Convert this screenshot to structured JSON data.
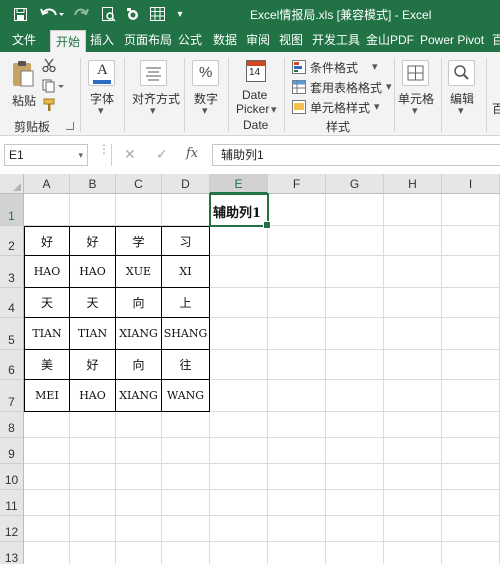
{
  "window": {
    "title": "Excel情报局.xls  [兼容模式]  -  Excel"
  },
  "tabs": [
    "文件",
    "开始",
    "插入",
    "页面布局",
    "公式",
    "数据",
    "审阅",
    "视图",
    "开发工具",
    "金山PDF",
    "Power Pivot",
    "百"
  ],
  "active_tab": "开始",
  "ribbon": {
    "paste": "粘贴",
    "clipboard": "剪贴板",
    "font": "字体",
    "align": "对齐方式",
    "number": "数字",
    "number_symbol": "%",
    "date_picker_1": "Date",
    "date_picker_2": "Picker",
    "date_group": "Date",
    "date_icon_num": "14",
    "cond_format": "条件格式",
    "table_format": "套用表格格式",
    "cell_style": "单元格样式",
    "styles_group": "样式",
    "cells": "单元格",
    "editing": "编辑",
    "font_icon_letter": "A"
  },
  "formula_bar": {
    "name_box": "E1",
    "fx": "fx",
    "content": "辅助列1"
  },
  "columns": [
    "A",
    "B",
    "C",
    "D",
    "E",
    "F",
    "G",
    "H",
    "I"
  ],
  "selected_column": "E",
  "selected_row": "1",
  "rows": [
    "1",
    "2",
    "3",
    "4",
    "5",
    "6",
    "7",
    "8",
    "9",
    "10",
    "11",
    "12",
    "13"
  ],
  "cells": {
    "E1": "辅助列1",
    "table": [
      [
        "好",
        "好",
        "学",
        "习"
      ],
      [
        "HAO",
        "HAO",
        "XUE",
        "XI"
      ],
      [
        "天",
        "天",
        "向",
        "上"
      ],
      [
        "TIAN",
        "TIAN",
        "XIANG",
        "SHANG"
      ],
      [
        "美",
        "好",
        "向",
        "往"
      ],
      [
        "MEI",
        "HAO",
        "XIANG",
        "WANG"
      ]
    ]
  }
}
